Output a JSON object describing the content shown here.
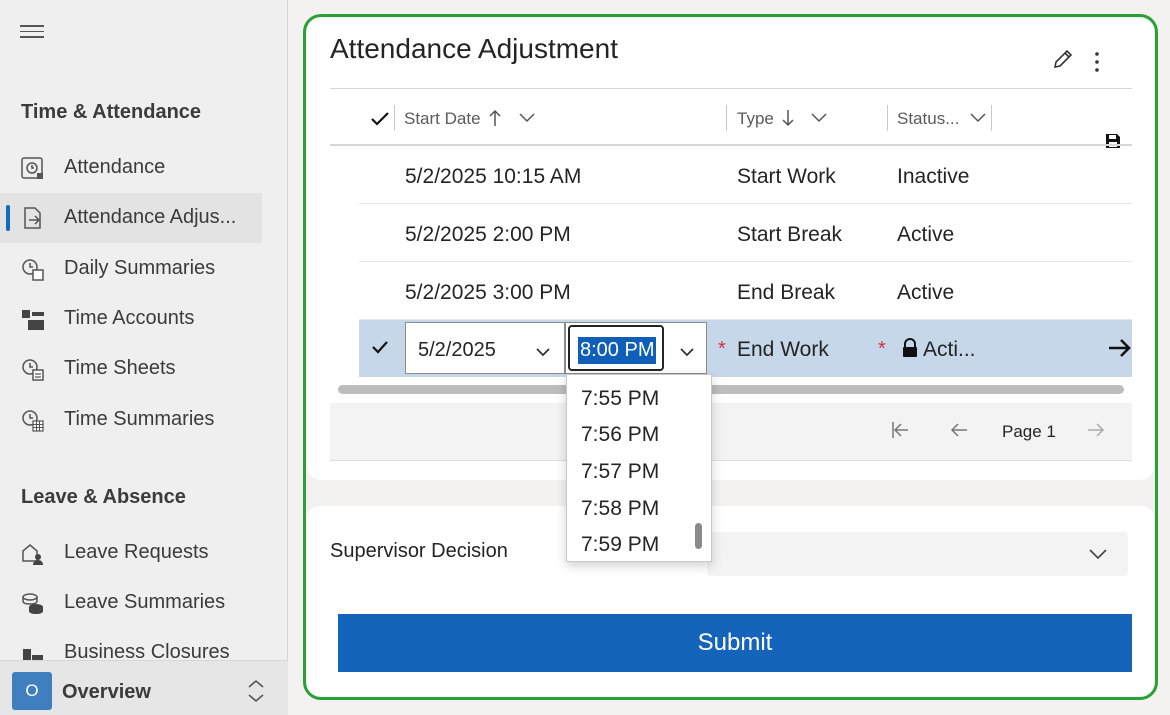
{
  "sidebar": {
    "sections": [
      {
        "title": "Time & Attendance",
        "items": [
          {
            "label": "Attendance",
            "icon": "clock-icon"
          },
          {
            "label": "Attendance Adjus...",
            "icon": "document-arrow-icon",
            "active": true
          },
          {
            "label": "Daily Summaries",
            "icon": "calendar-clock-icon"
          },
          {
            "label": "Time Accounts",
            "icon": "accounts-icon"
          },
          {
            "label": "Time Sheets",
            "icon": "timesheet-icon"
          },
          {
            "label": "Time Summaries",
            "icon": "summary-grid-icon"
          }
        ]
      },
      {
        "title": "Leave & Absence",
        "items": [
          {
            "label": "Leave Requests",
            "icon": "leave-request-icon"
          },
          {
            "label": "Leave Summaries",
            "icon": "coins-icon"
          },
          {
            "label": "Business Closures",
            "icon": "building-icon"
          }
        ]
      }
    ],
    "area": {
      "badge": "O",
      "label": "Overview"
    }
  },
  "card": {
    "title": "Attendance Adjustment",
    "columns": [
      {
        "label": "Start Date",
        "sort": "asc"
      },
      {
        "label": "Type",
        "sort": "desc"
      },
      {
        "label": "Status..."
      }
    ],
    "rows": [
      {
        "start": "5/2/2025 10:15 AM",
        "type": "Start Work",
        "status": "Inactive"
      },
      {
        "start": "5/2/2025 2:00 PM",
        "type": "Start Break",
        "status": "Active"
      },
      {
        "start": "5/2/2025 3:00 PM",
        "type": "End Break",
        "status": "Active"
      }
    ],
    "edit_row": {
      "date": "5/2/2025",
      "time": "8:00 PM",
      "type": "End Work",
      "status": "Acti...",
      "required_mark": "*"
    },
    "time_options": [
      "7:55 PM",
      "7:56 PM",
      "7:57 PM",
      "7:58 PM",
      "7:59 PM"
    ],
    "pager": {
      "label": "Page 1"
    }
  },
  "supervisor": {
    "label": "Supervisor Decision",
    "value": ""
  },
  "submit": {
    "label": "Submit"
  },
  "colors": {
    "accent": "#0f6cbd",
    "focus": "#2aa134",
    "selected_row": "#c6d7ea",
    "required": "#d13438"
  }
}
